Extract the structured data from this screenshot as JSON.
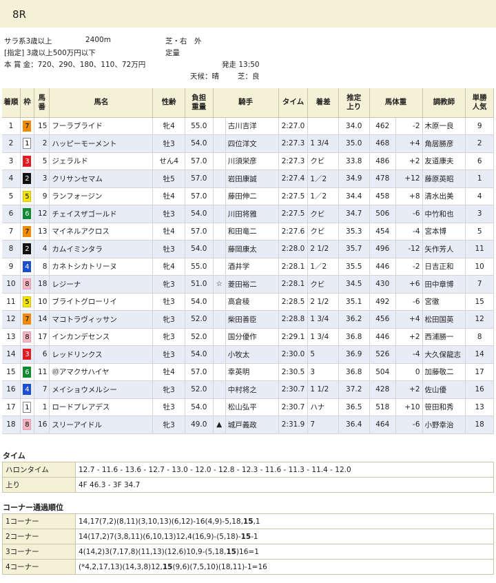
{
  "race": {
    "number": "8R",
    "class": "サラ系3歳以上",
    "distance": "2400m",
    "course": "芝・右　外",
    "condition": "[指定] 3歳以上500万円以下",
    "weight_rule": "定量",
    "prize": "本 賞 金：720、290、180、110、72万円",
    "start_time": "発走 13:50",
    "weather": "天候：晴",
    "track": "芝：良"
  },
  "table": {
    "headers": {
      "rank": "着順",
      "waku": "枠",
      "num": "馬\n番",
      "name": "馬名",
      "sex_age": "性齢",
      "weight": "負担\n重量",
      "jockey": "騎手",
      "time": "タイム",
      "margin": "着差",
      "last3f": "推定\n上り",
      "body": "馬体重",
      "trainer": "調教師",
      "pop": "単勝\n人気"
    },
    "rows": [
      {
        "rank": "1",
        "waku": "7",
        "num": "15",
        "name": "フーラブライド",
        "sex": "牝4",
        "wt": "55.0",
        "mark": "",
        "jockey": "古川吉洋",
        "time": "2:27.0",
        "margin": "",
        "l3f": "34.0",
        "bw": "462",
        "diff": "-2",
        "trainer": "木原一良",
        "pop": "9"
      },
      {
        "rank": "2",
        "waku": "1",
        "num": "2",
        "name": "ハッピーモーメント",
        "sex": "牡3",
        "wt": "54.0",
        "mark": "",
        "jockey": "四位洋文",
        "time": "2:27.3",
        "margin": "1 3/4",
        "l3f": "35.0",
        "bw": "468",
        "diff": "+4",
        "trainer": "角居勝彦",
        "pop": "2"
      },
      {
        "rank": "3",
        "waku": "3",
        "num": "5",
        "name": "ジェラルド",
        "sex": "せん4",
        "wt": "57.0",
        "mark": "",
        "jockey": "川須栄彦",
        "time": "2:27.3",
        "margin": "クビ",
        "l3f": "33.8",
        "bw": "486",
        "diff": "+2",
        "trainer": "友道康夫",
        "pop": "6"
      },
      {
        "rank": "4",
        "waku": "2",
        "num": "3",
        "name": "クリサンセマム",
        "sex": "牡5",
        "wt": "57.0",
        "mark": "",
        "jockey": "岩田康誠",
        "time": "2:27.4",
        "margin": "1／2",
        "l3f": "34.9",
        "bw": "478",
        "diff": "+12",
        "trainer": "藤原英昭",
        "pop": "1"
      },
      {
        "rank": "5",
        "waku": "5",
        "num": "9",
        "name": "ランフォージン",
        "sex": "牡4",
        "wt": "57.0",
        "mark": "",
        "jockey": "藤田伸二",
        "time": "2:27.5",
        "margin": "1／2",
        "l3f": "34.4",
        "bw": "458",
        "diff": "+8",
        "trainer": "清水出美",
        "pop": "4"
      },
      {
        "rank": "6",
        "waku": "6",
        "num": "12",
        "name": "チェイスザゴールド",
        "sex": "牡3",
        "wt": "54.0",
        "mark": "",
        "jockey": "川田将雅",
        "time": "2:27.5",
        "margin": "クビ",
        "l3f": "34.7",
        "bw": "506",
        "diff": "-6",
        "trainer": "中竹和也",
        "pop": "3"
      },
      {
        "rank": "7",
        "waku": "7",
        "num": "13",
        "name": "マイネルアクロス",
        "sex": "牡4",
        "wt": "57.0",
        "mark": "",
        "jockey": "和田竜二",
        "time": "2:27.6",
        "margin": "クビ",
        "l3f": "35.3",
        "bw": "454",
        "diff": "-4",
        "trainer": "宮本博",
        "pop": "5"
      },
      {
        "rank": "8",
        "waku": "2",
        "num": "4",
        "name": "カムイミンタラ",
        "sex": "牡3",
        "wt": "54.0",
        "mark": "",
        "jockey": "藤岡康太",
        "time": "2:28.0",
        "margin": "2 1/2",
        "l3f": "35.7",
        "bw": "496",
        "diff": "-12",
        "trainer": "矢作芳人",
        "pop": "11"
      },
      {
        "rank": "9",
        "waku": "4",
        "num": "8",
        "name": "カネトシカトリーヌ",
        "sex": "牝4",
        "wt": "55.0",
        "mark": "",
        "jockey": "酒井学",
        "time": "2:28.1",
        "margin": "1／2",
        "l3f": "35.5",
        "bw": "446",
        "diff": "-2",
        "trainer": "日吉正和",
        "pop": "10"
      },
      {
        "rank": "10",
        "waku": "8",
        "num": "18",
        "name": "レジーナ",
        "sex": "牝3",
        "wt": "51.0",
        "mark": "☆",
        "jockey": "菱田裕二",
        "time": "2:28.1",
        "margin": "クビ",
        "l3f": "34.5",
        "bw": "430",
        "diff": "+6",
        "trainer": "田中章博",
        "pop": "7"
      },
      {
        "rank": "11",
        "waku": "5",
        "num": "10",
        "name": "ブライトグローリイ",
        "sex": "牡3",
        "wt": "54.0",
        "mark": "",
        "jockey": "高倉稜",
        "time": "2:28.5",
        "margin": "2 1/2",
        "l3f": "35.1",
        "bw": "492",
        "diff": "-6",
        "trainer": "宮徹",
        "pop": "15"
      },
      {
        "rank": "12",
        "waku": "7",
        "num": "14",
        "name": "マコトラヴィッサン",
        "sex": "牝3",
        "wt": "52.0",
        "mark": "",
        "jockey": "柴田善臣",
        "time": "2:28.8",
        "margin": "1 3/4",
        "l3f": "36.2",
        "bw": "456",
        "diff": "+4",
        "trainer": "松田国英",
        "pop": "12"
      },
      {
        "rank": "13",
        "waku": "8",
        "num": "17",
        "name": "インカンデセンス",
        "sex": "牝3",
        "wt": "52.0",
        "mark": "",
        "jockey": "国分優作",
        "time": "2:29.1",
        "margin": "1 3/4",
        "l3f": "36.8",
        "bw": "446",
        "diff": "+2",
        "trainer": "西浦勝一",
        "pop": "8"
      },
      {
        "rank": "14",
        "waku": "3",
        "num": "6",
        "name": "レッドリンクス",
        "sex": "牡3",
        "wt": "54.0",
        "mark": "",
        "jockey": "小牧太",
        "time": "2:30.0",
        "margin": "5",
        "l3f": "36.9",
        "bw": "526",
        "diff": "-4",
        "trainer": "大久保龍志",
        "pop": "14"
      },
      {
        "rank": "15",
        "waku": "6",
        "num": "11",
        "name": "アマクサハイヤ",
        "sex": "牡4",
        "wt": "57.0",
        "mark": "",
        "jockey": "幸英明",
        "time": "2:30.5",
        "margin": "3",
        "l3f": "36.8",
        "bw": "504",
        "diff": "0",
        "trainer": "加藤敬二",
        "pop": "17",
        "prefix": "㊞"
      },
      {
        "rank": "16",
        "waku": "4",
        "num": "7",
        "name": "メイショウメルシー",
        "sex": "牝3",
        "wt": "52.0",
        "mark": "",
        "jockey": "中村将之",
        "time": "2:30.7",
        "margin": "1 1/2",
        "l3f": "37.2",
        "bw": "428",
        "diff": "+2",
        "trainer": "佐山優",
        "pop": "16"
      },
      {
        "rank": "17",
        "waku": "1",
        "num": "1",
        "name": "ロードプレアデス",
        "sex": "牡3",
        "wt": "54.0",
        "mark": "",
        "jockey": "松山弘平",
        "time": "2:30.7",
        "margin": "ハナ",
        "l3f": "36.5",
        "bw": "518",
        "diff": "+10",
        "trainer": "笹田和秀",
        "pop": "13"
      },
      {
        "rank": "18",
        "waku": "8",
        "num": "16",
        "name": "スリーアイドル",
        "sex": "牝3",
        "wt": "49.0",
        "mark": "▲",
        "jockey": "城戸義政",
        "time": "2:31.9",
        "margin": "7",
        "l3f": "36.4",
        "bw": "464",
        "diff": "-6",
        "trainer": "小野幸治",
        "pop": "18"
      }
    ]
  },
  "time_section": {
    "title": "タイム",
    "furlong_label": "ハロンタイム",
    "furlong_value": "12.7 - 11.6 - 13.6 - 12.7 - 13.0 - 12.0 - 12.8 - 12.3 - 11.6 - 11.3 - 11.4 - 12.0",
    "agari_label": "上り",
    "agari_value": "4F 46.3 - 3F 34.7"
  },
  "corner_section": {
    "title": "コーナー通過順位",
    "rows": [
      {
        "label": "1コーナー",
        "pre": "14,17(7,2)(8,11)(3,10,13)(6,12)-16(4,9)-5,18,",
        "bold": "15",
        "post": ",1"
      },
      {
        "label": "2コーナー",
        "pre": "14(17,2)7(3,8,11)(6,10,13)12,4(16,9)-(5,18)-",
        "bold": "15",
        "post": "-1"
      },
      {
        "label": "3コーナー",
        "pre": "4(14,2)3(7,17,8)(11,13)(12,6)10,9-(5,18,",
        "bold": "15",
        "post": ")16=1"
      },
      {
        "label": "4コーナー",
        "pre": "(*4,2,17,13)(14,3,8)12,",
        "bold": "15",
        "post": "(9,6)(7,5,10)(18,11)-1=16"
      }
    ]
  }
}
